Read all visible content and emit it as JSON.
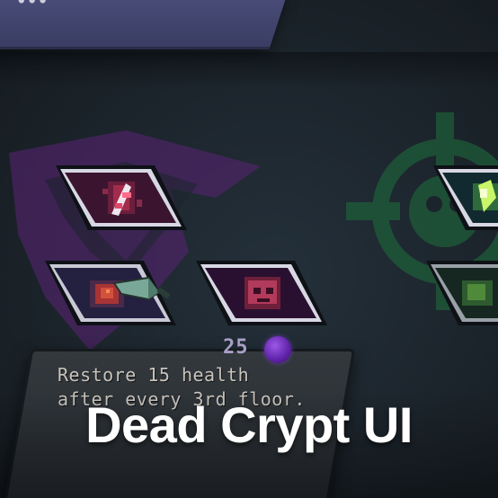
{
  "header": {
    "banner_title": "..."
  },
  "items": [
    {
      "id": "relic-claw",
      "icon": "red-claw-relic-icon",
      "accent": "#e0476a"
    },
    {
      "id": "relic-green-crystal",
      "icon": "green-crystal-relic-icon",
      "accent": "#7fe35a"
    },
    {
      "id": "relic-red-orb",
      "icon": "red-orb-relic-icon",
      "accent": "#c8413c"
    },
    {
      "id": "relic-red-skull",
      "icon": "red-skull-relic-icon",
      "accent": "#c44660"
    },
    {
      "id": "relic-green-dark",
      "icon": "green-swirl-relic-icon",
      "accent": "#4f8a3a"
    }
  ],
  "cursor": {
    "icon": "dagger-cursor-icon"
  },
  "selected": {
    "cost": "25",
    "currency_icon": "purple-soul-gem-icon",
    "description": "Restore 15 health\nafter every 3rd floor."
  },
  "overlay": {
    "title": "Dead Crypt UI"
  },
  "colors": {
    "background": "#1a2228",
    "card_frame": "#c9c9d6",
    "emblem_left": "#6a2b86",
    "emblem_right": "#1f6b3d"
  }
}
